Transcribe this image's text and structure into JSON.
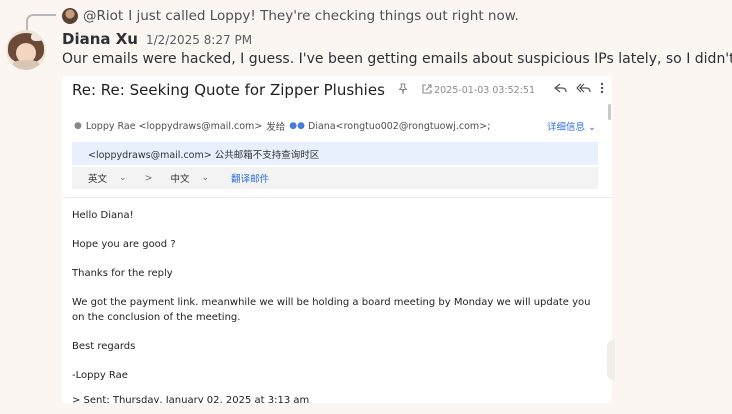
{
  "reply": {
    "mention": "@Riot",
    "text": "I just called Loppy! They're checking things out right now."
  },
  "message": {
    "author": "Diana Xu",
    "timestamp": "1/2/2025 8:27 PM",
    "text": "Our emails were hacked, I guess. I've been getting emails about suspicious IPs lately, so I didn't thin"
  },
  "email": {
    "subject": "Re: Re: Seeking Quote for Zipper Plushies",
    "date": "2025-01-03 03:52:51",
    "from": "Loppy Rae <loppydraws@mail.com>",
    "sent_verb": "发给",
    "to": "Diana<rongtuo002@rongtuowj.com>;",
    "details_label": "详细信息",
    "warning": "<loppydraws@mail.com> 公共邮箱不支持查询时区",
    "translate": {
      "source_lang": "英文",
      "arrow": ">",
      "target_lang": "中文",
      "action": "翻译邮件"
    },
    "body": {
      "greeting": "Hello Diana!",
      "line1": "Hope you are good ?",
      "line2": "Thanks for the reply",
      "line3": "We got the payment link. meanwhile we will be holding a board meeting by Monday we will update you on the conclusion of the meeting.",
      "closing": "Best regards",
      "signature": "-Loppy Rae",
      "quoted": "> Sent: Thursday, January 02, 2025 at 3:13 am"
    }
  },
  "icons": [
    "pin-icon",
    "popout-icon",
    "reply-icon",
    "reply-all-icon",
    "more-icon",
    "person-icon",
    "group-icon",
    "chevron-down-icon"
  ]
}
